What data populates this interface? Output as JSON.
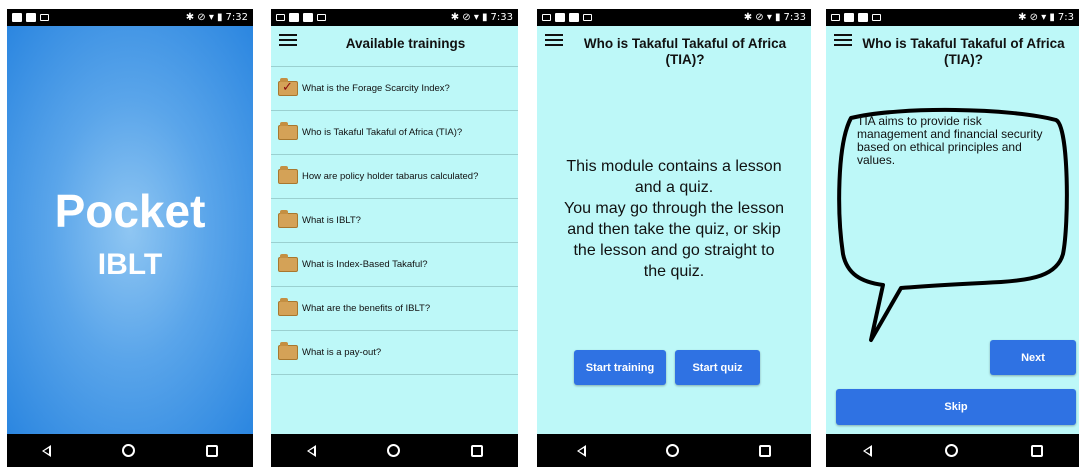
{
  "status_times": [
    "7:32",
    "7:33",
    "7:33",
    "7:3"
  ],
  "splash": {
    "title": "Pocket",
    "subtitle": "IBLT"
  },
  "trainings": {
    "header": "Available trainings",
    "items": [
      {
        "label": "What is the Forage Scarcity Index?",
        "checked": true
      },
      {
        "label": "Who is Takaful Takaful of Africa (TIA)?",
        "checked": false
      },
      {
        "label": "How are policy holder tabarus calculated?",
        "checked": false
      },
      {
        "label": "What is IBLT?",
        "checked": false
      },
      {
        "label": "What is Index-Based Takaful?",
        "checked": false
      },
      {
        "label": "What are the benefits of IBLT?",
        "checked": false
      },
      {
        "label": "What is a pay-out?",
        "checked": false
      }
    ]
  },
  "module": {
    "header": "Who is Takaful Takaful of Africa (TIA)?",
    "lines": [
      "This module contains a lesson",
      "and a quiz.",
      "You may go through the lesson",
      "and then take the quiz, or skip",
      "the lesson and go straight to",
      "the quiz."
    ],
    "start_training": "Start training",
    "start_quiz": "Start quiz"
  },
  "lesson": {
    "header": "Who is Takaful Takaful of Africa (TIA)?",
    "bubble_text": "TIA aims to provide risk management and financial security based on ethical principles and values.",
    "next": "Next",
    "skip": "Skip"
  },
  "colors": {
    "app_background": "#bdf8f8",
    "button_blue": "#2f72e3",
    "splash_blue": "#2b86e0",
    "folder": "#d4a257",
    "check": "#8b0f0f"
  },
  "icons": [
    "menu-icon",
    "folder-icon",
    "checkmark-icon",
    "back-icon",
    "home-icon",
    "recents-icon",
    "wifi-icon",
    "battery-icon",
    "bluetooth-icon"
  ]
}
